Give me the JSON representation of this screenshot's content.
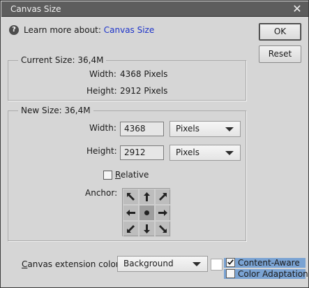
{
  "dialog": {
    "title": "Canvas Size",
    "close_label": "✕"
  },
  "help": {
    "prefix": "Learn more about:",
    "link": "Canvas Size"
  },
  "buttons": {
    "ok": "OK",
    "reset": "Reset"
  },
  "current_size": {
    "legend": "Current Size: 36,4M",
    "width_label": "Width:",
    "width_value": "4368 Pixels",
    "height_label": "Height:",
    "height_value": "2912 Pixels"
  },
  "new_size": {
    "legend": "New Size: 36,4M",
    "width_label": "Width:",
    "width_value": "4368",
    "width_unit": "Pixels",
    "height_label": "Height:",
    "height_value": "2912",
    "height_unit": "Pixels",
    "relative_mnemonic": "R",
    "relative_rest": "elative",
    "relative_checked": false,
    "anchor_label": "Anchor:",
    "anchor_icons": [
      "arrow-up-left-icon",
      "arrow-up-icon",
      "arrow-up-right-icon",
      "arrow-left-icon",
      "anchor-dot-icon",
      "arrow-right-icon",
      "arrow-down-left-icon",
      "arrow-down-icon",
      "arrow-down-right-icon"
    ]
  },
  "extension": {
    "label_mnemonic": "C",
    "label_rest": "anvas extension color:",
    "value": "Background",
    "swatch_color": "#ffffff",
    "content_aware": {
      "label": "Content-Aware",
      "checked": true
    },
    "color_adaptation": {
      "label": "Color Adaptation",
      "checked": false
    }
  },
  "colors": {
    "link": "#1d33c9",
    "highlight": "#7aa3d3"
  }
}
